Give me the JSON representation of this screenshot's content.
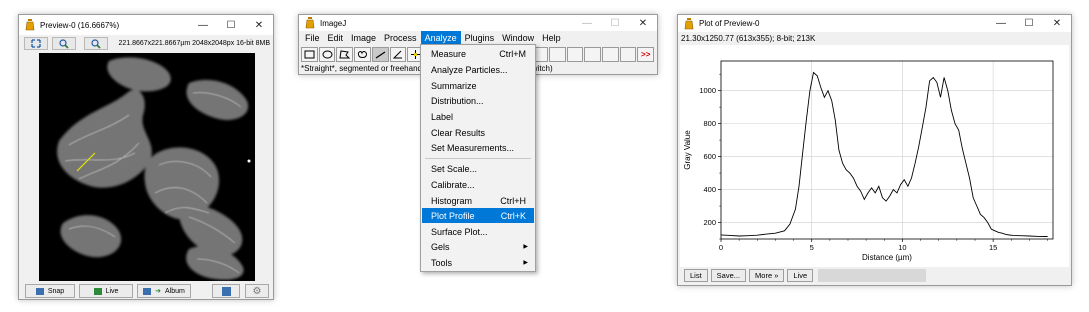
{
  "preview_window": {
    "title": "Preview-0 (16.6667%)",
    "info": "221.8667x221.8667µm  2048x2048px  16-bit 8MB",
    "buttons": {
      "snap": "Snap",
      "live": "Live",
      "album": "Album"
    }
  },
  "imagej_window": {
    "title": "ImageJ",
    "menus": [
      "File",
      "Edit",
      "Image",
      "Process",
      "Analyze",
      "Plugins",
      "Window",
      "Help"
    ],
    "active_menu": "Analyze",
    "status_text": "*Straight*, segmented or freehand lines, or arrows (right click to switch)",
    "more_tools": ">>"
  },
  "analyze_menu": {
    "items": [
      {
        "label": "Measure",
        "shortcut": "Ctrl+M"
      },
      {
        "label": "Analyze Particles...",
        "shortcut": ""
      },
      {
        "label": "Summarize",
        "shortcut": ""
      },
      {
        "label": "Distribution...",
        "shortcut": ""
      },
      {
        "label": "Label",
        "shortcut": ""
      },
      {
        "label": "Clear Results",
        "shortcut": ""
      },
      {
        "label": "Set Measurements...",
        "shortcut": ""
      },
      {
        "label": "Set Scale...",
        "shortcut": ""
      },
      {
        "label": "Calibrate...",
        "shortcut": ""
      },
      {
        "label": "Histogram",
        "shortcut": "Ctrl+H"
      },
      {
        "label": "Plot Profile",
        "shortcut": "Ctrl+K"
      },
      {
        "label": "Surface Plot...",
        "shortcut": ""
      },
      {
        "label": "Gels",
        "shortcut": ""
      },
      {
        "label": "Tools",
        "shortcut": ""
      }
    ],
    "highlighted": "Plot Profile"
  },
  "plot_window": {
    "title": "Plot of Preview-0",
    "subtitle": "21.30x1250.77  (613x355); 8-bit; 213K",
    "buttons": {
      "list": "List",
      "save": "Save...",
      "more": "More »",
      "live": "Live"
    }
  },
  "chart_data": {
    "type": "line",
    "xlabel": "Distance (µm)",
    "ylabel": "Gray Value",
    "xlim": [
      0,
      18.3
    ],
    "ylim": [
      100,
      1180
    ],
    "xticks": [
      0,
      5,
      10,
      15
    ],
    "yticks": [
      200,
      400,
      600,
      800,
      1000
    ],
    "grid": true,
    "series": [
      {
        "x": [
          0,
          0.5,
          1,
          1.5,
          2,
          2.5,
          3,
          3.5,
          3.8,
          4.1,
          4.3,
          4.5,
          4.7,
          4.9,
          5.1,
          5.3,
          5.5,
          5.7,
          5.9,
          6.1,
          6.3,
          6.5,
          6.7,
          6.9,
          7.1,
          7.3,
          7.5,
          7.7,
          7.9,
          8.1,
          8.3,
          8.5,
          8.7,
          8.9,
          9.1,
          9.3,
          9.5,
          9.7,
          9.9,
          10.1,
          10.3,
          10.5,
          10.7,
          10.9,
          11.1,
          11.3,
          11.5,
          11.7,
          11.9,
          12.1,
          12.3,
          12.5,
          12.7,
          12.9,
          13.1,
          13.3,
          13.5,
          13.7,
          13.9,
          14.1,
          14.3,
          14.5,
          14.7,
          14.9,
          15.1,
          15.3,
          15.5,
          15.7,
          15.9,
          16.1,
          16.5,
          17,
          17.5,
          18
        ],
        "y": [
          125,
          122,
          118,
          120,
          123,
          130,
          135,
          150,
          190,
          280,
          420,
          620,
          820,
          1000,
          1110,
          1090,
          1020,
          960,
          1000,
          940,
          820,
          640,
          560,
          520,
          500,
          470,
          420,
          390,
          340,
          380,
          410,
          380,
          420,
          350,
          330,
          360,
          400,
          380,
          430,
          460,
          420,
          470,
          560,
          660,
          780,
          900,
          1060,
          1080,
          1050,
          960,
          1080,
          1000,
          880,
          800,
          760,
          650,
          560,
          470,
          350,
          300,
          250,
          230,
          200,
          160,
          150,
          140,
          135,
          128,
          124,
          122,
          120,
          118,
          116,
          115
        ]
      }
    ]
  }
}
